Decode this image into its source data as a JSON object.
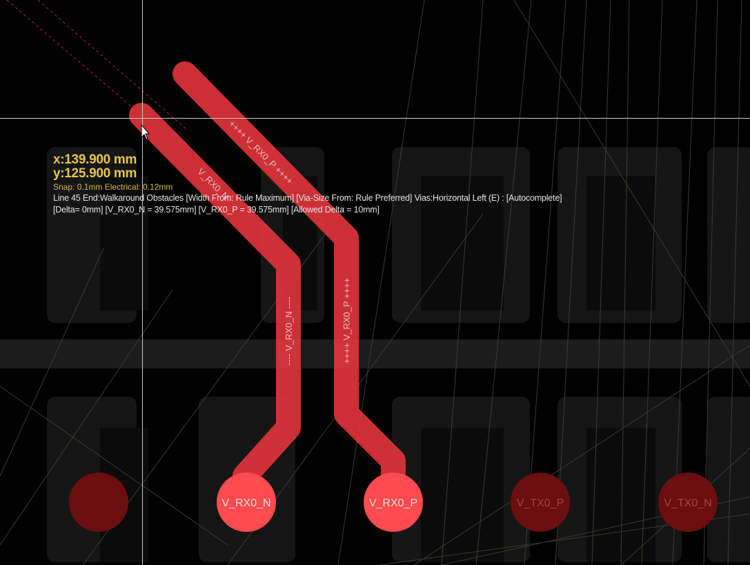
{
  "cursor": {
    "x": "x:139.900 mm",
    "y": "y:125.900 mm"
  },
  "snap_text": "Snap: 0.1mm Electrical: 0.12mm",
  "status_line1": "Line 45 End:Walkaround Obstacles [Width From: Rule Maximum] [Via-Size From: Rule Preferred] Vias:Horizontal Left (E) : [Autocomplete]",
  "status_line2": "[Delta= 0mm] [V_RX0_N = 39.575mm] [V_RX0_P = 39.575mm] [Allowed Delta = 10mm]",
  "trace_labels": {
    "rx_n_diagonal": "V_RX0_N",
    "rx_p_diagonal": "++++ V_RX0_P ++++",
    "rx_n_vertical": "---- V_RX0_N ----",
    "rx_p_vertical": "++++ V_RX0_P ++++"
  },
  "pads": [
    {
      "label": "",
      "state": "dim"
    },
    {
      "label": "V_RX0_N",
      "state": "active"
    },
    {
      "label": "V_RX0_P",
      "state": "active"
    },
    {
      "label": "V_TX0_P",
      "state": "dim"
    },
    {
      "label": "V_TX0_N",
      "state": "dim"
    }
  ],
  "colors": {
    "background": "#000000",
    "trace_active": "#e8363c",
    "pad_active": "#ff4a4f",
    "pad_dim": "#6a0e10",
    "coord_text": "#e8c64a",
    "crosshair": "#cfcfcf"
  }
}
